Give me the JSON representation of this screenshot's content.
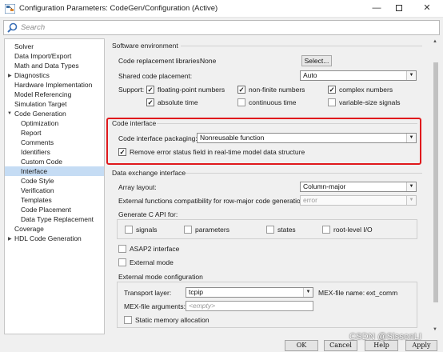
{
  "window": {
    "title": "Configuration Parameters: CodeGen/Configuration (Active)",
    "minimize": "—",
    "close": "✕"
  },
  "search": {
    "placeholder": "Search"
  },
  "tree": {
    "items": [
      {
        "label": "Solver"
      },
      {
        "label": "Data Import/Export"
      },
      {
        "label": "Math and Data Types"
      },
      {
        "label": "Diagnostics"
      },
      {
        "label": "Hardware Implementation"
      },
      {
        "label": "Model Referencing"
      },
      {
        "label": "Simulation Target"
      },
      {
        "label": "Code Generation"
      },
      {
        "label": "Optimization"
      },
      {
        "label": "Report"
      },
      {
        "label": "Comments"
      },
      {
        "label": "Identifiers"
      },
      {
        "label": "Custom Code"
      },
      {
        "label": "Interface"
      },
      {
        "label": "Code Style"
      },
      {
        "label": "Verification"
      },
      {
        "label": "Templates"
      },
      {
        "label": "Code Placement"
      },
      {
        "label": "Data Type Replacement"
      },
      {
        "label": "Coverage"
      },
      {
        "label": "HDL Code Generation"
      }
    ],
    "selected": "Interface"
  },
  "software_env": {
    "title": "Software environment",
    "code_replacement_label": "Code replacement libraries:",
    "code_replacement_value": "None",
    "select_button": "Select...",
    "shared_code_label": "Shared code placement:",
    "shared_code_value": "Auto",
    "support_label": "Support:",
    "support": [
      {
        "label": "floating-point numbers",
        "checked": true
      },
      {
        "label": "non-finite numbers",
        "checked": true
      },
      {
        "label": "complex numbers",
        "checked": true
      },
      {
        "label": "absolute time",
        "checked": true
      },
      {
        "label": "continuous time",
        "checked": false
      },
      {
        "label": "variable-size signals",
        "checked": false
      }
    ]
  },
  "code_interface": {
    "title": "Code interface",
    "packaging_label": "Code interface packaging:",
    "packaging_value": "Nonreusable function",
    "remove_error_label": "Remove error status field in real-time model data structure",
    "remove_error_checked": true,
    "highlight_color": "#e0191c"
  },
  "data_exchange": {
    "title": "Data exchange interface",
    "array_layout_label": "Array layout:",
    "array_layout_value": "Column-major",
    "ext_func_label": "External functions compatibility for row-major code generation:",
    "ext_func_value": "error",
    "capi_title": "Generate C API for:",
    "capi": [
      {
        "label": "signals",
        "checked": false
      },
      {
        "label": "parameters",
        "checked": false
      },
      {
        "label": "states",
        "checked": false
      },
      {
        "label": "root-level I/O",
        "checked": false
      }
    ],
    "asap2_label": "ASAP2 interface",
    "external_mode_label": "External mode",
    "ext_mode_config_title": "External mode configuration",
    "transport_label": "Transport layer:",
    "transport_value": "tcpip",
    "mex_file_name_label": "MEX-file name:",
    "mex_file_name_value": "ext_comm",
    "mex_args_label": "MEX-file arguments:",
    "mex_args_placeholder": "<empty>",
    "static_mem_label": "Static memory allocation"
  },
  "buttons": {
    "ok": "OK",
    "cancel": "Cancel",
    "help": "Help",
    "apply": "Apply"
  },
  "watermark": "CSDN @SissonLI"
}
